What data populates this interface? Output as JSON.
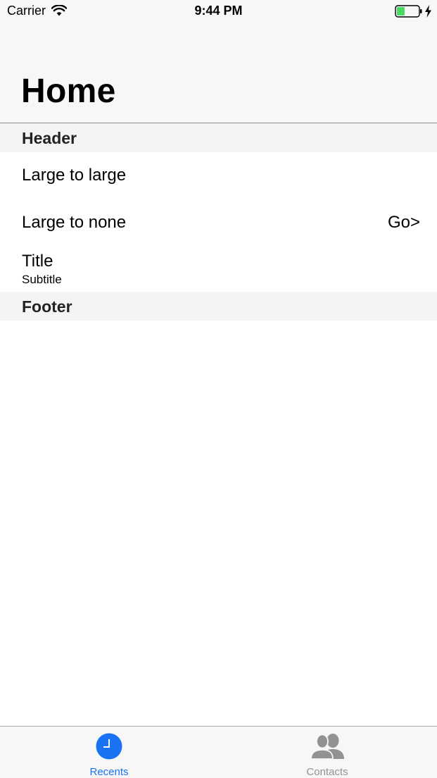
{
  "status_bar": {
    "carrier": "Carrier",
    "time": "9:44 PM",
    "icons": [
      "wifi-icon",
      "battery-icon",
      "charging-bolt-icon"
    ],
    "battery_color": "#4cd964"
  },
  "nav": {
    "title": "Home"
  },
  "table": {
    "header": "Header",
    "footer": "Footer",
    "rows": [
      {
        "label": "Large to large"
      },
      {
        "label": "Large to none",
        "detail": "Go>"
      },
      {
        "label": "Title",
        "subtitle": "Subtitle"
      }
    ]
  },
  "tab_bar": {
    "accent_color": "#1a73f2",
    "inactive_color": "#929292",
    "tabs": [
      {
        "label": "Recents",
        "icon": "clock-icon",
        "selected": true
      },
      {
        "label": "Contacts",
        "icon": "contacts-icon",
        "selected": false
      }
    ]
  }
}
